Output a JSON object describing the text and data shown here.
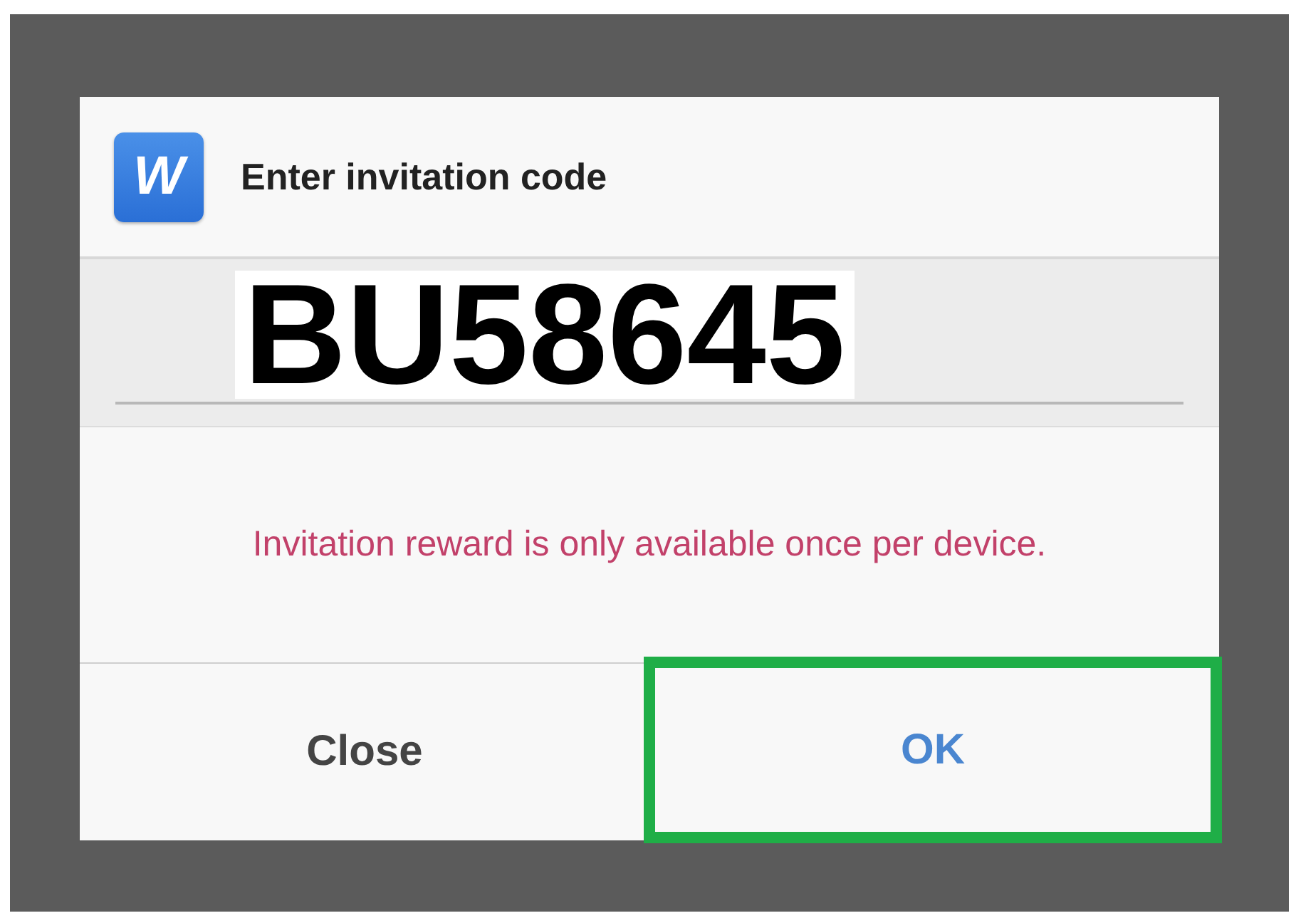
{
  "dialog": {
    "title": "Enter invitation code",
    "app_icon_letter": "W",
    "code_field": {
      "value": "BU58645"
    },
    "message": "Invitation reward is only available once per device.",
    "buttons": [
      {
        "label": "Close",
        "kind": "neutral",
        "highlighted": false
      },
      {
        "label": "OK",
        "kind": "primary",
        "highlighted": true
      }
    ]
  }
}
